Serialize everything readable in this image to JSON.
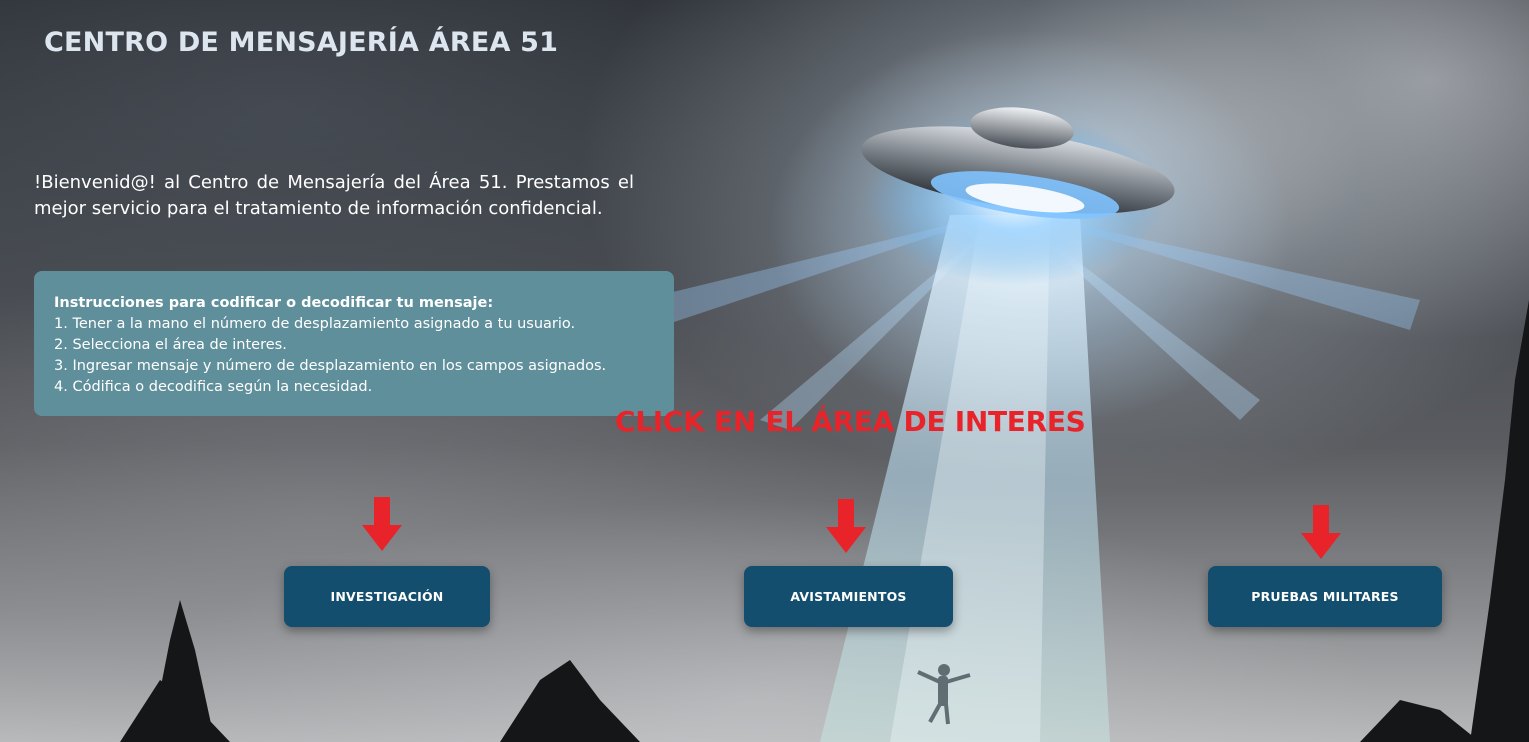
{
  "header": {
    "title": "CENTRO DE MENSAJERÍA ÁREA 51"
  },
  "welcome": {
    "text": "!Bienvenid@! al Centro de Mensajería del Área 51. Prestamos el mejor servicio para el tratamiento de información confidencial."
  },
  "instructions": {
    "heading": "Instrucciones para codificar o decodificar tu mensaje:",
    "steps": [
      "1. Tener a la mano el número de desplazamiento asignado a tu usuario.",
      "2. Selecciona el área de interes.",
      "3. Ingresar mensaje y número de desplazamiento en los campos asignados.",
      "4. Códifica o decodifica según la necesidad."
    ]
  },
  "cta": {
    "label": "CLICK EN EL ÁREA DE INTERES",
    "color": "#e8242a"
  },
  "areas": [
    {
      "label": "INVESTIGACIÓN",
      "arrow_icon": "arrow-down-icon"
    },
    {
      "label": "AVISTAMIENTOS",
      "arrow_icon": "arrow-down-icon"
    },
    {
      "label": "PRUEBAS MILITARES",
      "arrow_icon": "arrow-down-icon"
    }
  ],
  "colors": {
    "button_bg": "#134e6e",
    "panel_bg": "#5f8f9b",
    "title_color": "#dde6ee",
    "arrow_color": "#e8242a"
  }
}
